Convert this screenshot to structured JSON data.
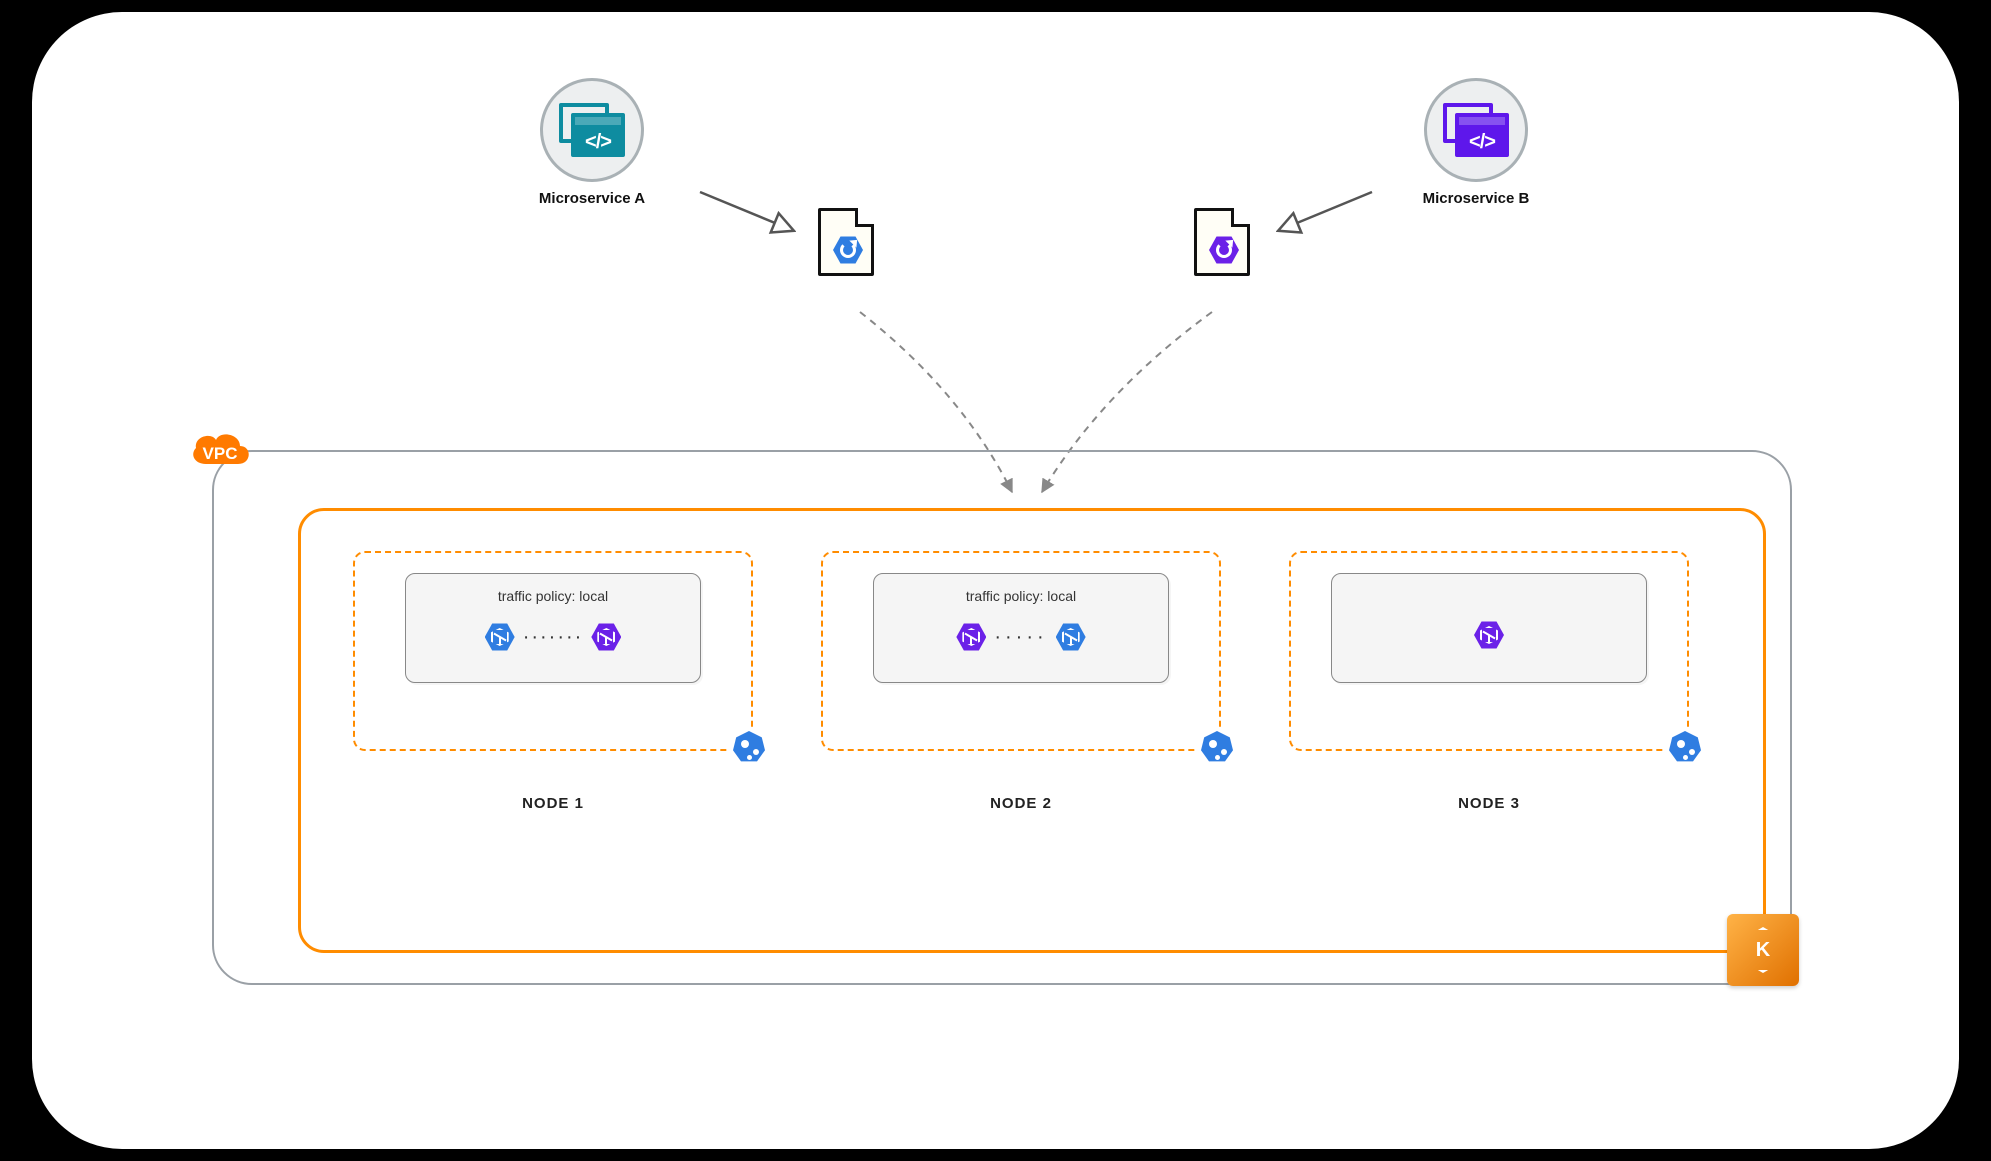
{
  "services": {
    "a": {
      "label": "Microservice A",
      "color": "teal"
    },
    "b": {
      "label": "Microservice B",
      "color": "purple"
    }
  },
  "vpc": {
    "badge": "VPC"
  },
  "cluster": {
    "eks_letter": "K"
  },
  "nodes": [
    {
      "label": "NODE 1",
      "traffic_policy": "traffic policy: local",
      "pods": [
        "blue",
        "purple"
      ],
      "dotted_line": true
    },
    {
      "label": "NODE 2",
      "traffic_policy": "traffic policy: local",
      "pods": [
        "purple",
        "blue"
      ],
      "dotted_line": true
    },
    {
      "label": "NODE 3",
      "traffic_policy": "",
      "pods": [
        "purple"
      ],
      "dotted_line": false
    }
  ],
  "code_glyph": "</>"
}
